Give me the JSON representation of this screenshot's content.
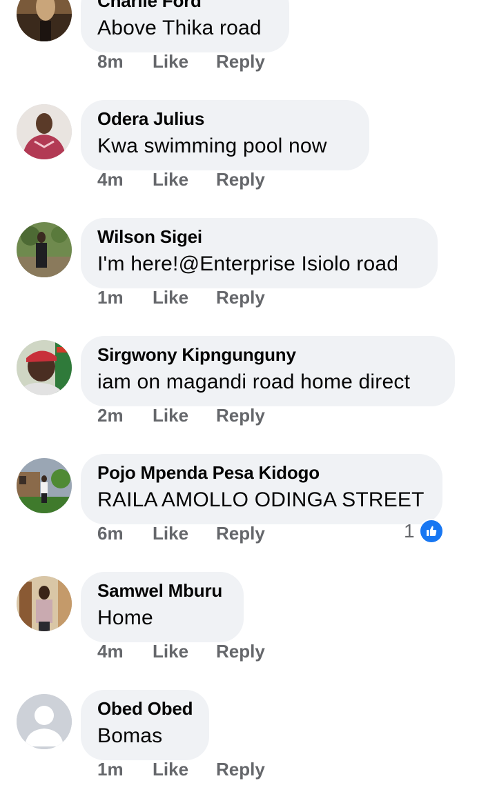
{
  "comments": [
    {
      "author": "Charlie Ford",
      "text": "Above Thika road",
      "time": "8m",
      "like": "Like",
      "reply": "Reply",
      "reactions": ""
    },
    {
      "author": "Odera Julius",
      "text": "Kwa swimming pool  now",
      "time": "4m",
      "like": "Like",
      "reply": "Reply",
      "reactions": ""
    },
    {
      "author": "Wilson Sigei",
      "text": "I'm here!@Enterprise Isiolo road",
      "time": "1m",
      "like": "Like",
      "reply": "Reply",
      "reactions": ""
    },
    {
      "author": "Sirgwony Kipngunguny",
      "text": "iam on magandi road home direct",
      "time": "2m",
      "like": "Like",
      "reply": "Reply",
      "reactions": ""
    },
    {
      "author": "Pojo Mpenda Pesa Kidogo",
      "text": "RAILA AMOLLO ODINGA STREET",
      "time": "6m",
      "like": "Like",
      "reply": "Reply",
      "reactions": "1"
    },
    {
      "author": "Samwel Mburu",
      "text": "Home",
      "time": "4m",
      "like": "Like",
      "reply": "Reply",
      "reactions": ""
    },
    {
      "author": "Obed Obed",
      "text": "Bomas",
      "time": "1m",
      "like": "Like",
      "reply": "Reply",
      "reactions": ""
    }
  ],
  "colors": {
    "bubble": "#f0f2f5",
    "meta_text": "#65676b",
    "like_badge": "#1877f2"
  },
  "icons": {
    "reaction": "thumbs-up-icon",
    "default_avatar": "default-person-icon"
  }
}
